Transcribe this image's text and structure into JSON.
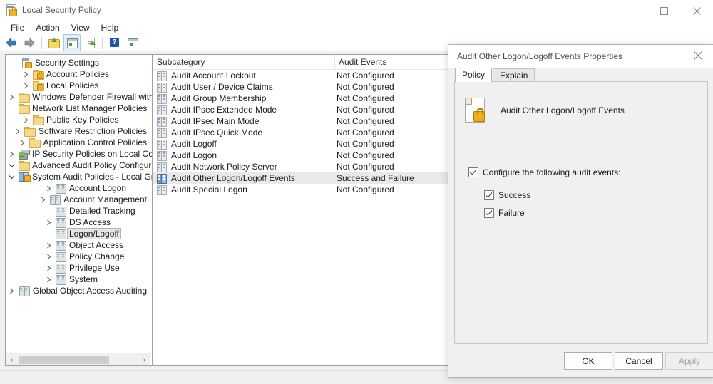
{
  "window": {
    "title": "Local Security Policy",
    "app_icon": "security-policy-icon",
    "controls": {
      "minimize": "Minimize",
      "maximize": "Maximize",
      "close": "Close"
    }
  },
  "menubar": {
    "items": [
      "File",
      "Action",
      "View",
      "Help"
    ]
  },
  "toolbar": {
    "buttons": [
      {
        "name": "back-button",
        "icon": "left-arrow-icon",
        "pressed": false
      },
      {
        "name": "forward-button",
        "icon": "right-arrow-icon",
        "pressed": false
      },
      {
        "name": "up-one-level-button",
        "icon": "folder-up-icon",
        "pressed": false
      },
      {
        "name": "show-hide-console-tree-button",
        "icon": "console-tree-icon",
        "pressed": true
      },
      {
        "name": "export-list-button",
        "icon": "export-document-icon",
        "pressed": false
      },
      {
        "name": "help-button",
        "icon": "question-mark-icon",
        "pressed": false
      },
      {
        "name": "view-options-button",
        "icon": "view-grid-icon",
        "pressed": false
      }
    ]
  },
  "tree": {
    "items": [
      {
        "label": "Security Settings",
        "indent": 0,
        "twisty": "none",
        "icon": "security-settings-icon",
        "selected": false
      },
      {
        "label": "Account Policies",
        "indent": 1,
        "twisty": "collapsed",
        "icon": "folder-lock-icon",
        "selected": false
      },
      {
        "label": "Local Policies",
        "indent": 1,
        "twisty": "collapsed",
        "icon": "folder-lock-icon",
        "selected": false
      },
      {
        "label": "Windows Defender Firewall with Advan",
        "indent": 1,
        "twisty": "collapsed",
        "icon": "folder-icon",
        "selected": false
      },
      {
        "label": "Network List Manager Policies",
        "indent": 1,
        "twisty": "none",
        "icon": "folder-icon",
        "selected": false
      },
      {
        "label": "Public Key Policies",
        "indent": 1,
        "twisty": "collapsed",
        "icon": "folder-icon",
        "selected": false
      },
      {
        "label": "Software Restriction Policies",
        "indent": 1,
        "twisty": "collapsed",
        "icon": "folder-icon",
        "selected": false
      },
      {
        "label": "Application Control Policies",
        "indent": 1,
        "twisty": "collapsed",
        "icon": "folder-icon",
        "selected": false
      },
      {
        "label": "IP Security Policies on Local Computer",
        "indent": 1,
        "twisty": "collapsed",
        "icon": "ip-security-icon",
        "selected": false
      },
      {
        "label": "Advanced Audit Policy Configuration",
        "indent": 1,
        "twisty": "expanded",
        "icon": "folder-icon",
        "selected": false
      },
      {
        "label": "System Audit Policies - Local Group",
        "indent": 2,
        "twisty": "expanded",
        "icon": "system-audit-icon",
        "selected": false
      },
      {
        "label": "Account Logon",
        "indent": 3,
        "twisty": "collapsed",
        "icon": "audit-category-icon",
        "selected": false
      },
      {
        "label": "Account Management",
        "indent": 3,
        "twisty": "collapsed",
        "icon": "audit-category-icon",
        "selected": false
      },
      {
        "label": "Detailed Tracking",
        "indent": 3,
        "twisty": "none",
        "icon": "audit-category-icon",
        "selected": false
      },
      {
        "label": "DS Access",
        "indent": 3,
        "twisty": "collapsed",
        "icon": "audit-category-icon",
        "selected": false
      },
      {
        "label": "Logon/Logoff",
        "indent": 3,
        "twisty": "none",
        "icon": "audit-category-icon",
        "selected": true
      },
      {
        "label": "Object Access",
        "indent": 3,
        "twisty": "collapsed",
        "icon": "audit-category-icon",
        "selected": false
      },
      {
        "label": "Policy Change",
        "indent": 3,
        "twisty": "collapsed",
        "icon": "audit-category-icon",
        "selected": false
      },
      {
        "label": "Privilege Use",
        "indent": 3,
        "twisty": "collapsed",
        "icon": "audit-category-icon",
        "selected": false
      },
      {
        "label": "System",
        "indent": 3,
        "twisty": "collapsed",
        "icon": "audit-category-icon",
        "selected": false
      },
      {
        "label": "Global Object Access Auditing",
        "indent": 3,
        "twisty": "collapsed",
        "icon": "audit-category-icon",
        "selected": false
      }
    ],
    "scrollbar": {
      "left_arrow": "‹",
      "right_arrow": "›"
    }
  },
  "list": {
    "columns": [
      "Subcategory",
      "Audit Events"
    ],
    "rows": [
      {
        "subcategory": "Audit Account Lockout",
        "audit_events": "Not Configured",
        "selected": false
      },
      {
        "subcategory": "Audit User / Device Claims",
        "audit_events": "Not Configured",
        "selected": false
      },
      {
        "subcategory": "Audit Group Membership",
        "audit_events": "Not Configured",
        "selected": false
      },
      {
        "subcategory": "Audit IPsec Extended Mode",
        "audit_events": "Not Configured",
        "selected": false
      },
      {
        "subcategory": "Audit IPsec Main Mode",
        "audit_events": "Not Configured",
        "selected": false
      },
      {
        "subcategory": "Audit IPsec Quick Mode",
        "audit_events": "Not Configured",
        "selected": false
      },
      {
        "subcategory": "Audit Logoff",
        "audit_events": "Not Configured",
        "selected": false
      },
      {
        "subcategory": "Audit Logon",
        "audit_events": "Not Configured",
        "selected": false
      },
      {
        "subcategory": "Audit Network Policy Server",
        "audit_events": "Not Configured",
        "selected": false
      },
      {
        "subcategory": "Audit Other Logon/Logoff Events",
        "audit_events": "Success and Failure",
        "selected": true
      },
      {
        "subcategory": "Audit Special Logon",
        "audit_events": "Not Configured",
        "selected": false
      }
    ]
  },
  "dialog": {
    "title": "Audit Other Logon/Logoff Events Properties",
    "close_icon": "close-icon",
    "tabs": [
      {
        "label": "Policy",
        "active": true
      },
      {
        "label": "Explain",
        "active": false
      }
    ],
    "policy_name": "Audit Other Logon/Logoff Events",
    "policy_icon": "document-lock-icon",
    "checkboxes": [
      {
        "label": "Configure the following audit events:",
        "checked": true,
        "name": "configure-audit-events-checkbox"
      },
      {
        "label": "Success",
        "checked": true,
        "name": "success-checkbox"
      },
      {
        "label": "Failure",
        "checked": true,
        "name": "failure-checkbox"
      }
    ],
    "buttons": [
      {
        "label": "OK",
        "name": "ok-button",
        "enabled": true
      },
      {
        "label": "Cancel",
        "name": "cancel-button",
        "enabled": true
      },
      {
        "label": "Apply",
        "name": "apply-button",
        "enabled": false
      }
    ]
  },
  "colors": {
    "accent": "#0078d7",
    "selection": "#e9e9e9",
    "window_bg": "#f0f0f0",
    "pane_bg": "#ffffff",
    "folder": "#f6d98a",
    "lock": "#f2b01e"
  }
}
